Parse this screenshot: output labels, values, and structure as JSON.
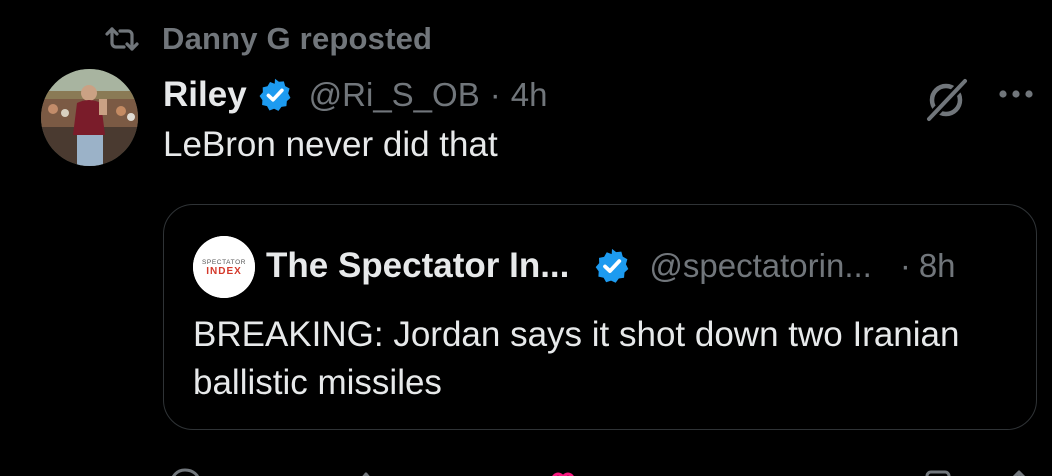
{
  "repost": {
    "icon": "repost-icon",
    "text": "Danny G reposted"
  },
  "post": {
    "avatar": "avatar-photo",
    "author_name": "Riley",
    "verified_icon": "verified-badge-icon",
    "handle": "@Ri_S_OB",
    "separator": "·",
    "time": "4h",
    "text": "LeBron never did that",
    "grok_icon": "grok-icon",
    "more_icon": "more-icon"
  },
  "quote": {
    "avatar_label": "SPECTATOR INDEX",
    "author_name": "The Spectator In...",
    "handle": "@spectatorin...",
    "separator": "·",
    "time": "8h",
    "text": "BREAKING: Jordan says it shot down two Iranian ballistic missiles"
  },
  "actions": {
    "icons": [
      "reply-icon",
      "repost-icon",
      "like-icon",
      "views-icon",
      "bookmark-icon",
      "share-icon"
    ]
  },
  "colors": {
    "background": "#000000",
    "primary_text": "#e7e9ea",
    "secondary_text": "#71767b",
    "border": "#2f3336",
    "verified_blue": "#1d9bf0",
    "like_pink": "#f91880"
  }
}
